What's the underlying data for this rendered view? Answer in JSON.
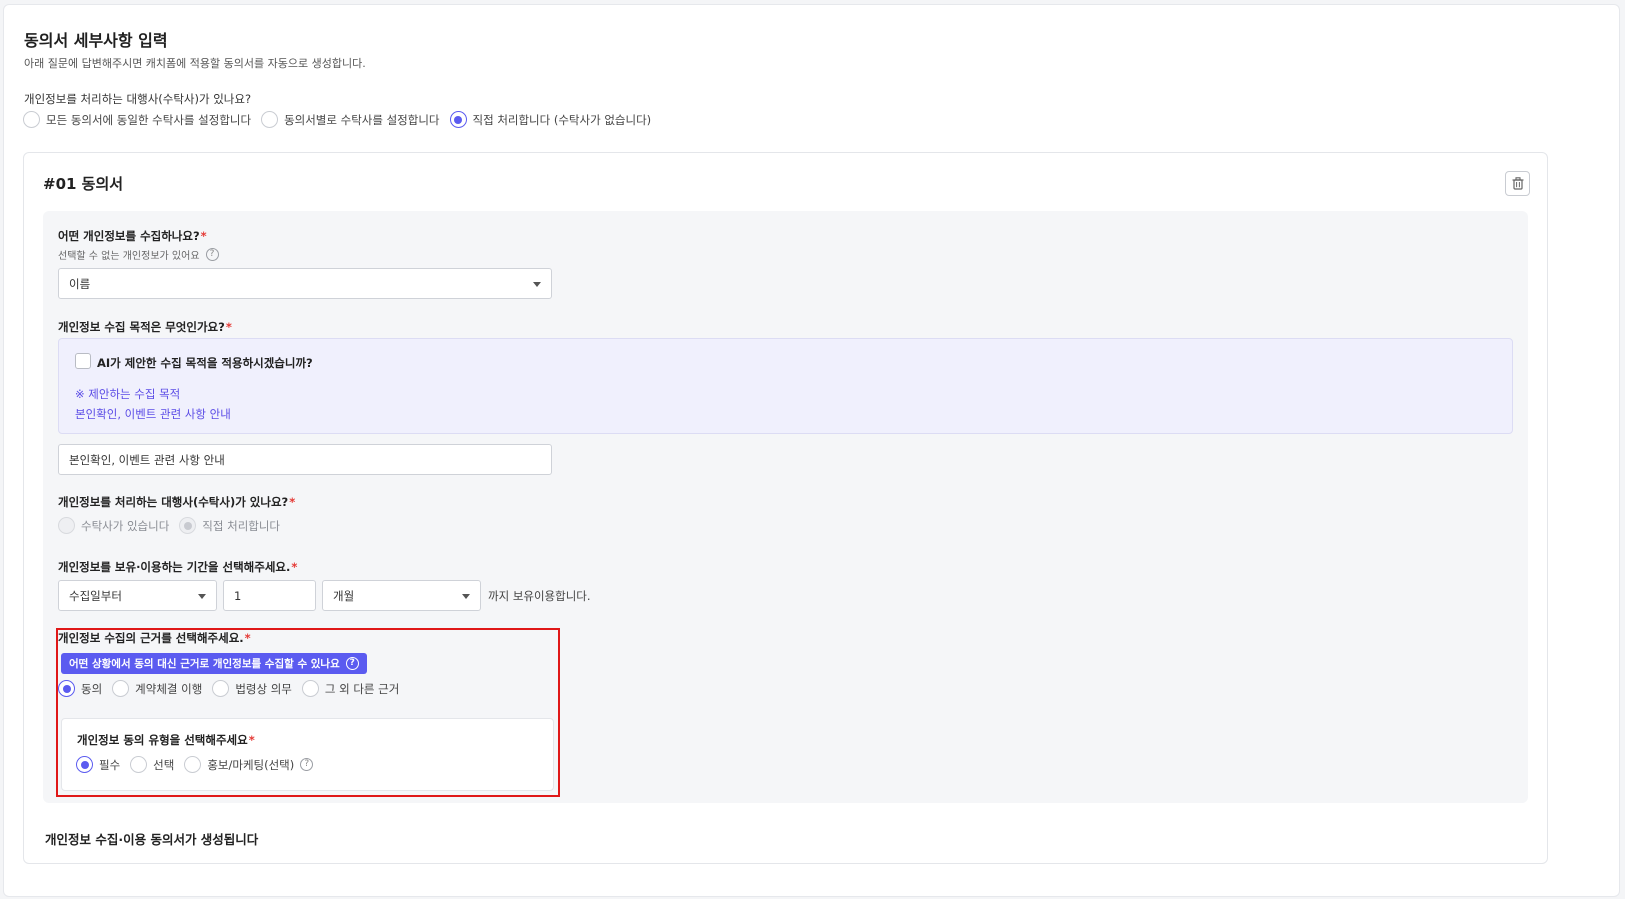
{
  "header": {
    "title": "동의서 세부사항 입력",
    "subtitle": "아래 질문에 답변해주시면 캐치폼에 적용할 동의서를 자동으로 생성합니다."
  },
  "top_question": {
    "label": "개인정보를 처리하는 대행사(수탁사)가 있나요?",
    "options": [
      "모든 동의서에 동일한 수탁사를 설정합니다",
      "동의서별로 수탁사를 설정합니다",
      "직접 처리합니다 (수탁사가 없습니다)"
    ],
    "selected": "직접 처리합니다 (수탁사가 없습니다)"
  },
  "consent": {
    "title": "#01 동의서",
    "collect": {
      "label": "어떤 개인정보를 수집하나요?",
      "required_mark": "*",
      "hint": "선택할 수 없는 개인정보가 있어요",
      "hint_icon": "?",
      "value": "이름"
    },
    "purpose": {
      "label": "개인정보 수집 목적은 무엇인가요?",
      "required_mark": "*",
      "ai_checkbox_label": "AI가 제안한 수집 목적을 적용하시겠습니까?",
      "ai_checked": false,
      "suggest_heading": "※ 제안하는 수집 목적",
      "suggest_text": "본인확인, 이벤트 관련 사항 안내",
      "value": "본인확인, 이벤트 관련 사항 안내"
    },
    "agency": {
      "label": "개인정보를 처리하는 대행사(수탁사)가 있나요?",
      "required_mark": "*",
      "options": [
        "수탁사가 있습니다",
        "직접 처리합니다"
      ],
      "selected": "직접 처리합니다",
      "disabled": true
    },
    "retention": {
      "label": "개인정보를 보유·이용하는 기간을 선택해주세요.",
      "required_mark": "*",
      "from": "수집일부터",
      "amount": "1",
      "unit": "개월",
      "suffix": "까지 보유이용합니다."
    },
    "basis": {
      "label": "개인정보 수집의 근거를 선택해주세요.",
      "required_mark": "*",
      "help_button": "어떤 상황에서 동의 대신 근거로 개인정보를 수집할 수 있나요",
      "help_icon": "?",
      "options": [
        "동의",
        "계약체결 이행",
        "법령상 의무",
        "그 외 다른 근거"
      ],
      "selected": "동의"
    },
    "consent_type": {
      "label": "개인정보 동의 유형을 선택해주세요",
      "required_mark": "*",
      "options": [
        "필수",
        "선택",
        "홍보/마케팅(선택)"
      ],
      "selected": "필수",
      "help_icon": "?"
    },
    "footer": "개인정보 수집·이용 동의서가 생성됩니다"
  },
  "colors": {
    "accent": "#5b5bf0",
    "highlight_border": "#e01818",
    "required": "#e53935",
    "ai_text": "#5b4ce6"
  },
  "icons": {
    "delete": "trash-icon",
    "dropdown": "caret-down-icon",
    "help": "question-circle-icon"
  }
}
